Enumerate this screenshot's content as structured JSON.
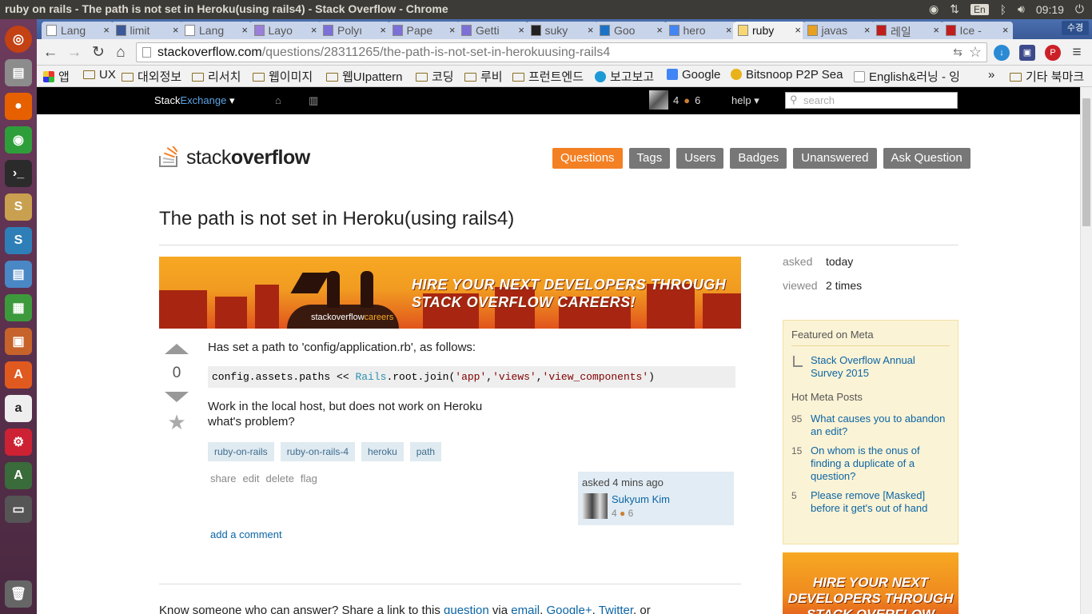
{
  "os": {
    "window_title": "ruby on rails - The path is not set in Heroku(using rails4) - Stack Overflow - Chrome",
    "lang": "En",
    "clock": "09:19"
  },
  "tabs": [
    {
      "label": "Lang"
    },
    {
      "label": "limit"
    },
    {
      "label": "Lang"
    },
    {
      "label": "Layo"
    },
    {
      "label": "Polyı"
    },
    {
      "label": "Pape"
    },
    {
      "label": "Getti"
    },
    {
      "label": "suky"
    },
    {
      "label": "Goo"
    },
    {
      "label": "hero"
    },
    {
      "label": "ruby"
    },
    {
      "label": "javas"
    },
    {
      "label": "레일"
    },
    {
      "label": "Ice -"
    }
  ],
  "profile_label": "수경",
  "url": {
    "host": "stackoverflow.com",
    "path": "/questions/28311265/the-path-is-not-set-in-herokuusing-rails4"
  },
  "bookmarks": [
    "앱",
    "UX",
    "대외정보",
    "리서치",
    "웹이미지",
    "웹UIpattern",
    "코딩",
    "루비",
    "프런트엔드",
    "보고보고",
    "Google",
    "Bitsnoop P2P Sea",
    "English&러닝 - 잉",
    "»",
    "기타 북마크"
  ],
  "se_bar": {
    "brand_a": "Stack",
    "brand_b": "Exchange",
    "rep": "4",
    "badge_count": "6",
    "help": "help",
    "search_placeholder": "search"
  },
  "logo": {
    "a": "stack",
    "b": "overflow"
  },
  "nav": [
    "Questions",
    "Tags",
    "Users",
    "Badges",
    "Unanswered",
    "Ask Question"
  ],
  "question": {
    "title": "The path is not set in Heroku(using rails4)",
    "votes": "0",
    "body_1": "Has set a path to 'config/application.rb', as follows:",
    "code_a": "config.assets.paths << ",
    "code_cls": "Rails",
    "code_b": ".root.join(",
    "code_s1": "'app'",
    "code_s2": "'views'",
    "code_s3": "'view_components'",
    "code_c": ")",
    "body_2": "Work in the local host, but does not work on Heroku",
    "body_3": "what's problem?",
    "tags": [
      "ruby-on-rails",
      "ruby-on-rails-4",
      "heroku",
      "path"
    ],
    "menu": [
      "share",
      "edit",
      "delete",
      "flag"
    ],
    "asked": "asked 4 mins ago",
    "author": "Sukyum Kim",
    "author_rep": "4",
    "author_badges": "6",
    "add_comment": "add a comment"
  },
  "banner": {
    "line1": "HIRE YOUR NEXT DEVELOPERS THROUGH",
    "line2": "STACK OVERFLOW CAREERS!",
    "logo_a": "stackoverflow",
    "logo_b": "careers"
  },
  "share": {
    "prefix": "Know someone who can answer? Share a link to this ",
    "link1": "question",
    "mid": " via ",
    "link2": "email",
    "sep1": ", ",
    "link3": "Google+",
    "sep2": ", ",
    "link4": "Twitter",
    "end": ", or"
  },
  "sidebar": {
    "asked_label": "asked",
    "asked_value": "today",
    "viewed_label": "viewed",
    "viewed_value": "2 times",
    "featured_heading": "Featured on Meta",
    "featured": [
      {
        "text": "Stack Overflow Annual Survey 2015"
      }
    ],
    "hot_heading": "Hot Meta Posts",
    "hot": [
      {
        "n": "95",
        "text": "What causes you to abandon an edit?"
      },
      {
        "n": "15",
        "text": "On whom is the onus of finding a duplicate of a question?"
      },
      {
        "n": "5",
        "text": "Please remove [Masked] before it get's out of hand"
      }
    ],
    "ad_text": "HIRE YOUR NEXT DEVELOPERS THROUGH STACK OVERFLOW"
  },
  "colors": {
    "accent": "#f48024",
    "link": "#0c65a5",
    "tag_bg": "#e0eaf1"
  }
}
